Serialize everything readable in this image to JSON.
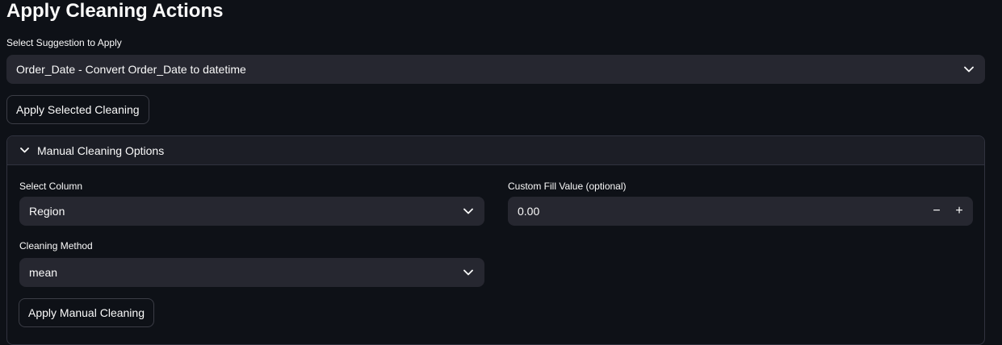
{
  "page": {
    "title": "Apply Cleaning Actions"
  },
  "suggestion": {
    "label": "Select Suggestion to Apply",
    "selected": "Order_Date - Convert Order_Date to datetime",
    "chevron_icon": "chevron-down-icon"
  },
  "apply_selected_button": {
    "label": "Apply Selected Cleaning"
  },
  "manual": {
    "expander_title": "Manual Cleaning Options",
    "expander_icon": "chevron-down-icon",
    "column": {
      "label": "Select Column",
      "selected": "Region"
    },
    "fill_value": {
      "label": "Custom Fill Value (optional)",
      "value": "0.00",
      "minus": "−",
      "plus": "+"
    },
    "method": {
      "label": "Cleaning Method",
      "selected": "mean"
    },
    "apply_button": {
      "label": "Apply Manual Cleaning"
    }
  },
  "colors": {
    "background": "#0e1117",
    "input_bg": "#262730",
    "expander_header_bg": "#1c1e26",
    "text": "#fafafa"
  }
}
